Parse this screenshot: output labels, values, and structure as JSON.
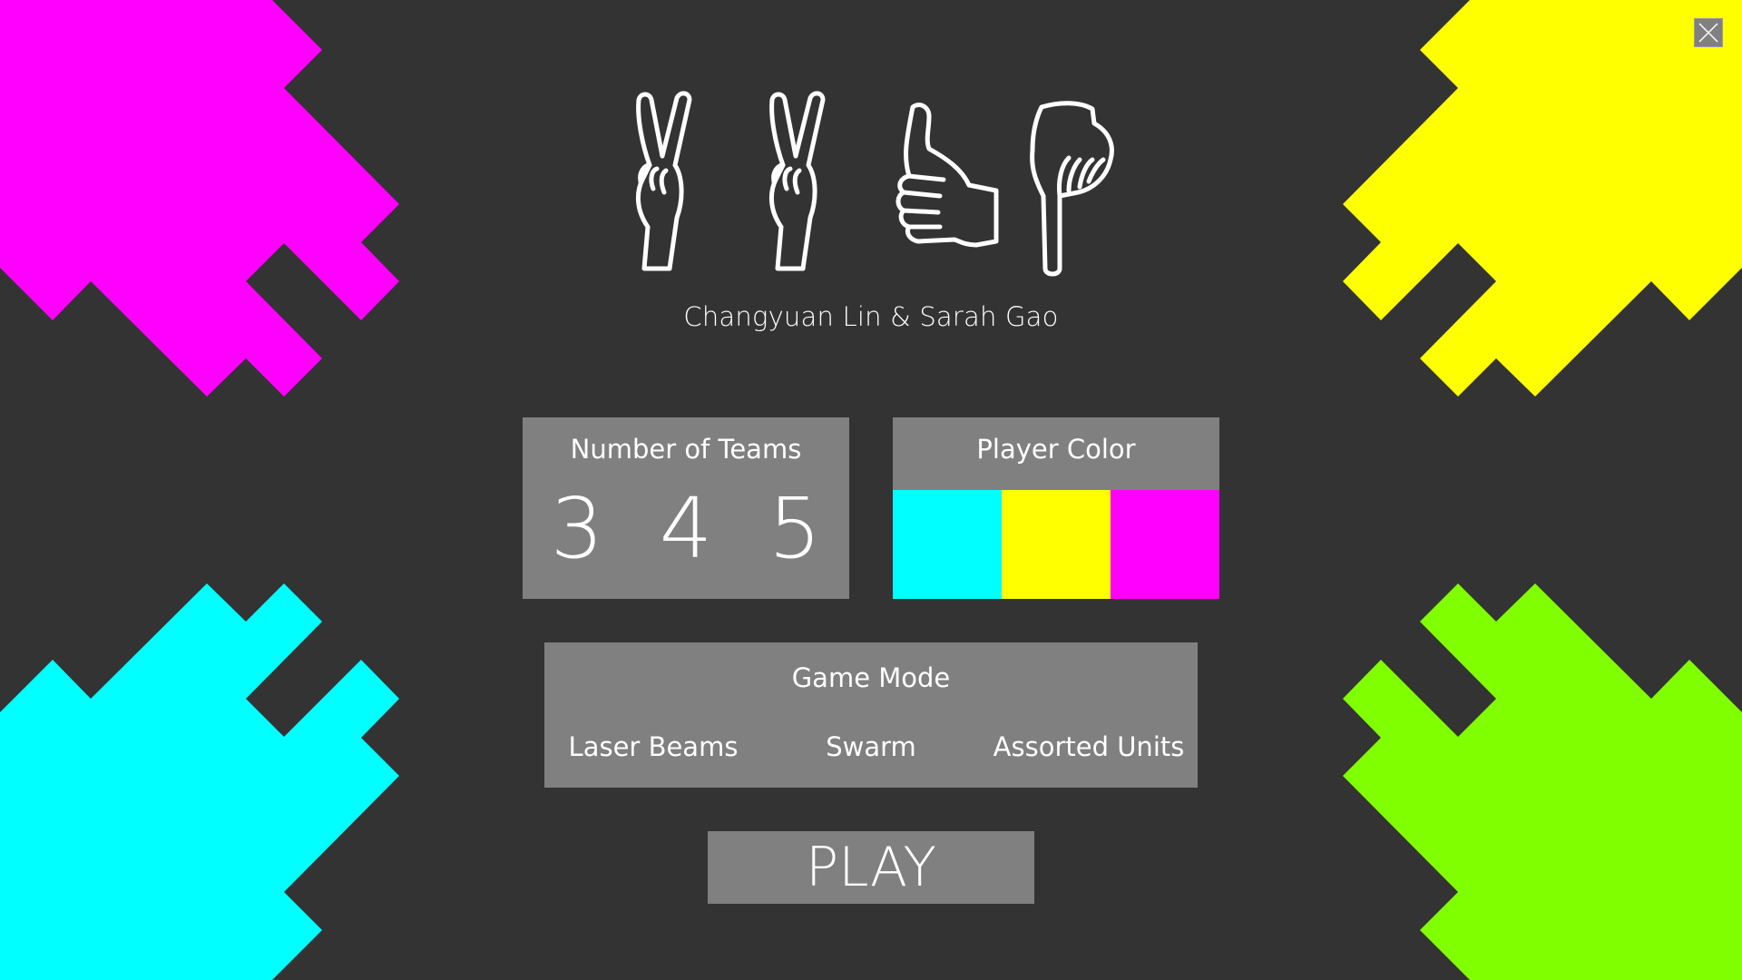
{
  "credits": "Changyuan Lin & Sarah Gao",
  "icons": [
    "peace-hand-icon",
    "peace-hand-icon",
    "thumbs-up-hand-icon",
    "pointing-down-hand-icon",
    "close-icon"
  ],
  "teams": {
    "title": "Number of Teams",
    "options": [
      "3",
      "4",
      "5"
    ]
  },
  "player_color": {
    "title": "Player Color",
    "swatches": [
      "#00ffff",
      "#ffff00",
      "#ff00ff"
    ]
  },
  "game_mode": {
    "title": "Game Mode",
    "options": [
      "Laser Beams",
      "Swarm",
      "Assorted Units"
    ]
  },
  "play_label": "PLAY",
  "colors": {
    "background": "#333333",
    "panel": "#808080",
    "magenta": "#ff00ff",
    "yellow": "#ffff00",
    "cyan": "#00ffff",
    "lime": "#80ff00"
  }
}
